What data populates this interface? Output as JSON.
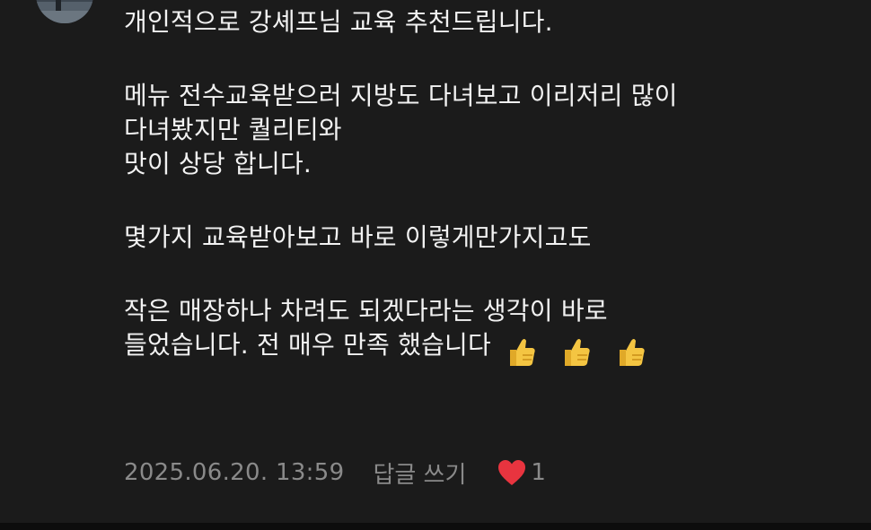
{
  "comment": {
    "avatar_icon": "user-avatar-photo",
    "lines": [
      "개인적으로 강셰프님 교육 추천드립니다.",
      "메뉴 전수교육받으러 지방도 다녀보고 이리저리 많이",
      "다녀봤지만 퀄리티와",
      "맛이 상당 합니다.",
      "몇가지 교육받아보고 바로 이렇게만가지고도",
      "작은 매장하나 차려도 되겠다라는 생각이 바로",
      "들었습니다. 전 매우 만족 했습니다"
    ],
    "emojis": [
      "thumbs-up-icon",
      "thumbs-up-icon",
      "thumbs-up-icon"
    ],
    "timestamp": "2025.06.20. 13:59",
    "reply_label": "답글 쓰기",
    "like_icon": "heart-icon",
    "like_count": "1",
    "colors": {
      "background": "#1b1b1b",
      "text": "#f2f2f2",
      "meta": "#8a8a8a",
      "heart": "#e8343f",
      "thumb": "#f4c542"
    }
  }
}
